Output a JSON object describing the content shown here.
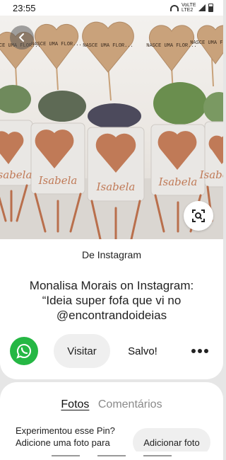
{
  "status_bar": {
    "time": "23:55",
    "network_label": "VoLTE LTE2"
  },
  "pin": {
    "image_alt": "Vasos com suculentas",
    "tags": [
      "NASCE UMA FLOR...",
      "NASCE UMA FLOR...",
      "NASCE UMA FLOR...",
      "NASCE UMA FLOR...",
      "NASCE UMA FLOR..."
    ],
    "pot_names": [
      "Isabela",
      "Isabela",
      "Isabela",
      "Isabela",
      "Isabela"
    ],
    "source": "De Instagram",
    "title": "Monalisa Morais on Instagram: “Ideia super fofa que vi no @encontrandoideias"
  },
  "actions": {
    "visit_label": "Visitar",
    "saved_label": "Salvo!"
  },
  "bottom_sheet": {
    "tab_photos": "Fotos",
    "tab_comments": "Comentários",
    "prompt": "Experimentou esse Pin? Adicione uma foto para",
    "add_photo_label": "Adicionar foto"
  },
  "colors": {
    "copper": "#c07a57",
    "whatsapp_green": "#25b744"
  }
}
